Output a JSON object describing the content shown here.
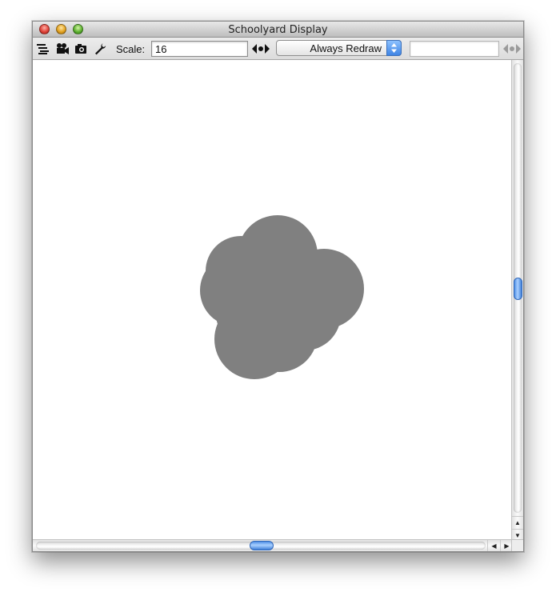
{
  "window": {
    "title": "Schoolyard Display"
  },
  "toolbar": {
    "icons": [
      "list-icon",
      "movie-camera-icon",
      "snapshot-camera-icon",
      "wrench-icon"
    ],
    "scale_label": "Scale:",
    "scale_value": "16",
    "redraw_mode": "Always Redraw",
    "speed_value": ""
  },
  "scrollbars": {
    "vertical_position": 0.5,
    "horizontal_position": 0.5
  },
  "colors": {
    "blob": "#808080",
    "canvas": "#ffffff",
    "accent": "#3f84e4"
  }
}
